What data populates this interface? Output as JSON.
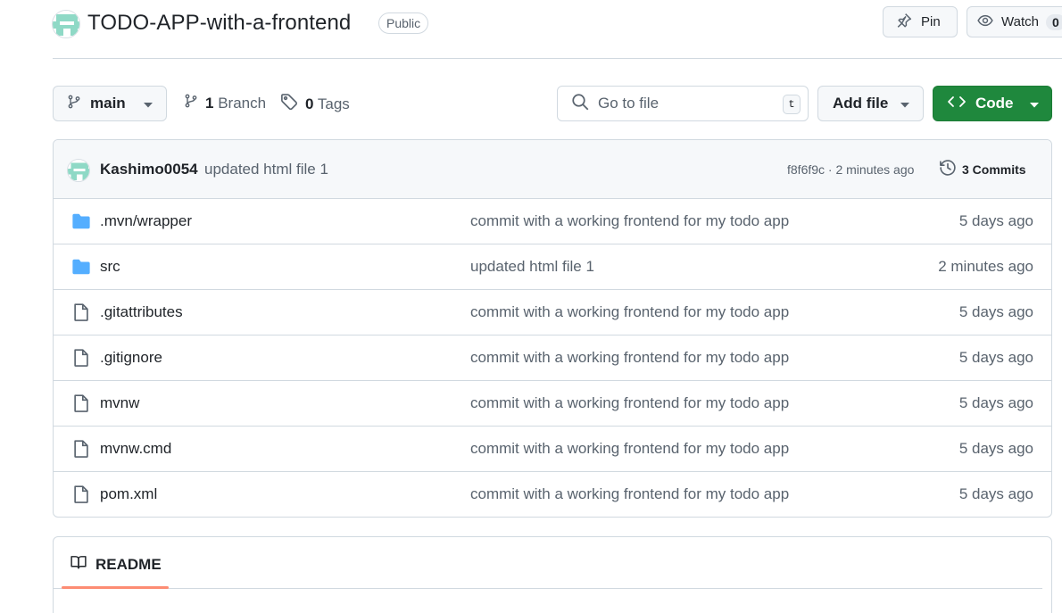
{
  "repo": {
    "name": "TODO-APP-with-a-frontend",
    "visibility": "Public",
    "pin_label": "Pin",
    "watch_label": "Watch",
    "watch_count": "0"
  },
  "toolbar": {
    "branch": "main",
    "branch_count": "1",
    "branch_label": "Branch",
    "tag_count": "0",
    "tag_label": "Tags",
    "search_placeholder": "Go to file",
    "search_shortcut": "t",
    "add_file_label": "Add file",
    "code_label": "Code"
  },
  "latest_commit": {
    "author": "Kashimo0054",
    "message": "updated html file 1",
    "meta": "f8f6f9c · 2 minutes ago",
    "commits_label": "3 Commits"
  },
  "files": [
    {
      "type": "folder",
      "name": ".mvn/wrapper",
      "message": "commit with a working frontend for my todo app",
      "age": "5 days ago"
    },
    {
      "type": "folder",
      "name": "src",
      "message": "updated html file 1",
      "age": "2 minutes ago"
    },
    {
      "type": "file",
      "name": ".gitattributes",
      "message": "commit with a working frontend for my todo app",
      "age": "5 days ago"
    },
    {
      "type": "file",
      "name": ".gitignore",
      "message": "commit with a working frontend for my todo app",
      "age": "5 days ago"
    },
    {
      "type": "file",
      "name": "mvnw",
      "message": "commit with a working frontend for my todo app",
      "age": "5 days ago"
    },
    {
      "type": "file",
      "name": "mvnw.cmd",
      "message": "commit with a working frontend for my todo app",
      "age": "5 days ago"
    },
    {
      "type": "file",
      "name": "pom.xml",
      "message": "commit with a working frontend for my todo app",
      "age": "5 days ago"
    }
  ],
  "readme": {
    "tab_label": "README"
  },
  "colors": {
    "accent_green": "#1f883d",
    "folder_blue": "#54aeff",
    "tab_underline": "#fd8c73",
    "avatar_teal": "#8fd9c6"
  },
  "icons": [
    "repo-avatar",
    "pin-icon",
    "eye-icon",
    "branch-icon",
    "tag-icon",
    "search-icon",
    "code-icon",
    "history-icon",
    "folder-icon",
    "file-icon",
    "book-icon",
    "caret-down-icon"
  ]
}
